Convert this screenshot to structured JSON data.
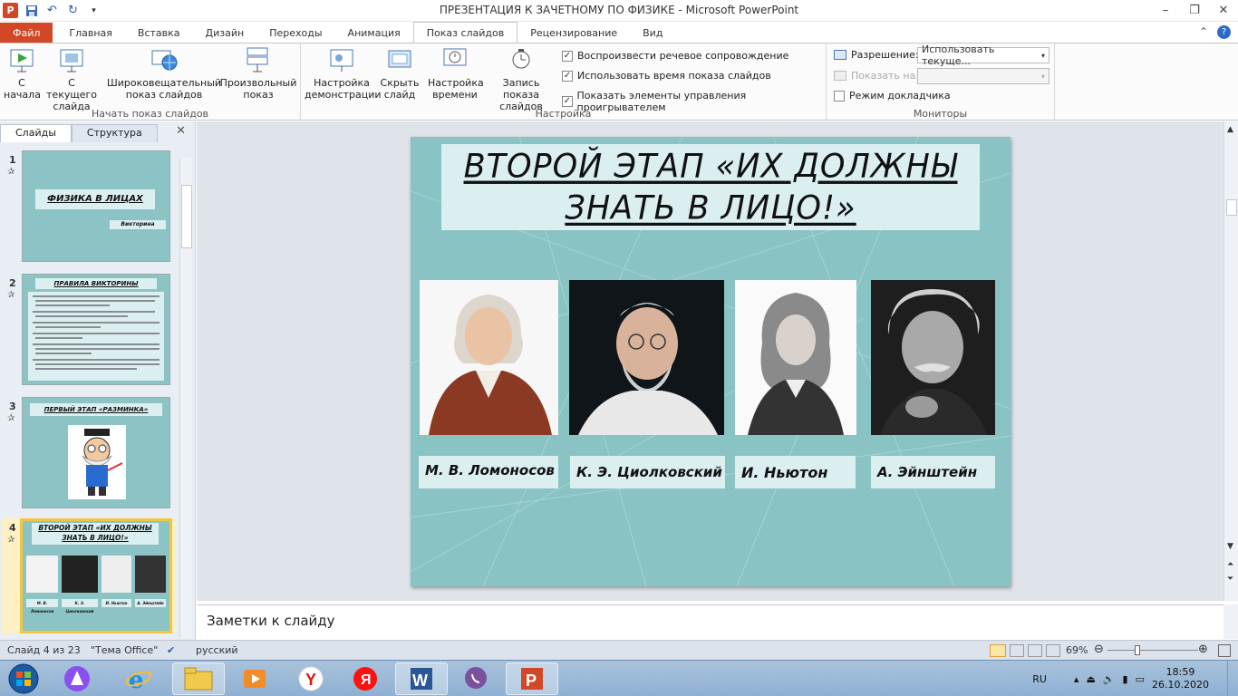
{
  "window": {
    "title": "ПРЕЗЕНТАЦИЯ К ЗАЧЕТНОМУ ПО ФИЗИКЕ  -  Microsoft PowerPoint",
    "minimize": "–",
    "restore": "❐",
    "close": "✕"
  },
  "tabs": [
    {
      "label": "Файл"
    },
    {
      "label": "Главная"
    },
    {
      "label": "Вставка"
    },
    {
      "label": "Дизайн"
    },
    {
      "label": "Переходы"
    },
    {
      "label": "Анимация"
    },
    {
      "label": "Показ слайдов"
    },
    {
      "label": "Рецензирование"
    },
    {
      "label": "Вид"
    }
  ],
  "ribbon": {
    "start_group": {
      "label": "Начать показ слайдов",
      "from_start": "С начала",
      "from_current": "С текущего слайда",
      "broadcast": "Широковещательный показ слайдов",
      "custom": "Произвольный показ"
    },
    "setup_group": {
      "label": "Настройка",
      "setup": "Настройка демонстрации",
      "hide": "Скрыть слайд",
      "rehearse": "Настройка времени",
      "record": "Запись показа слайдов",
      "chk_narration": "Воспроизвести речевое сопровождение",
      "chk_timings": "Использовать время показа слайдов",
      "chk_controls": "Показать элементы управления проигрывателем"
    },
    "monitors_group": {
      "label": "Мониторы",
      "resolution_label": "Разрешение:",
      "resolution_value": "Использовать текуще...",
      "show_on_label": "Показать на:",
      "presenter_view": "Режим докладчика"
    }
  },
  "leftpane": {
    "tab_slides": "Слайды",
    "tab_outline": "Структура",
    "thumbs": [
      {
        "num": "1",
        "title": "ФИЗИКА В ЛИЦАХ",
        "subtitle": "Викторина"
      },
      {
        "num": "2",
        "title": "ПРАВИЛА ВИКТОРИНЫ"
      },
      {
        "num": "3",
        "title": "ПЕРВЫЙ ЭТАП «РАЗМИНКА»"
      },
      {
        "num": "4",
        "title": "ВТОРОЙ ЭТАП «ИХ ДОЛЖНЫ ЗНАТЬ В ЛИЦО!»",
        "names": [
          "М. В. Ломоносов",
          "К. Э. Циолковский",
          "И. Ньютон",
          "А. Эйнштейн"
        ]
      }
    ]
  },
  "slide": {
    "title_line1": "ВТОРОЙ ЭТАП «ИХ ДОЛЖНЫ",
    "title_line2": "ЗНАТЬ В ЛИЦО!»",
    "people": [
      {
        "name": "М. В. Ломоносов"
      },
      {
        "name": "К. Э. Циолковский"
      },
      {
        "name": "И. Ньютон"
      },
      {
        "name": "А. Эйнштейн"
      }
    ]
  },
  "notes": {
    "placeholder": "Заметки к слайду"
  },
  "status": {
    "slide_info": "Слайд 4 из 23",
    "theme": "\"Тема Office\"",
    "language": "русский",
    "zoom": "69%"
  },
  "taskbar": {
    "lang": "RU",
    "time": "18:59",
    "date": "26.10.2020"
  }
}
